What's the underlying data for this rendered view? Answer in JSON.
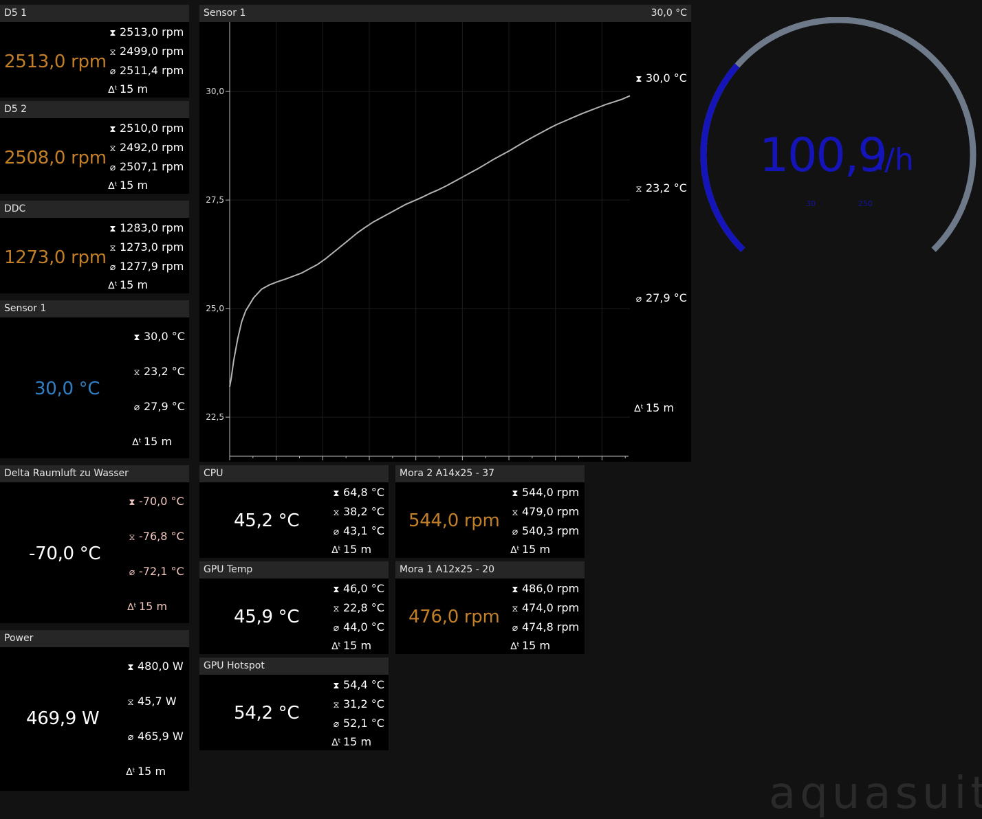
{
  "units": {
    "rpm": "rpm",
    "temp": "°C",
    "watt": "W",
    "time": "15 m"
  },
  "panels": {
    "d5_1": {
      "title": "D5 1",
      "value": "2513,0 rpm",
      "max": "2513,0 rpm",
      "min": "2499,0 rpm",
      "avg": "2511,4 rpm",
      "dt": "15 m"
    },
    "d5_2": {
      "title": "D5 2",
      "value": "2508,0 rpm",
      "max": "2510,0 rpm",
      "min": "2492,0 rpm",
      "avg": "2507,1 rpm",
      "dt": "15 m"
    },
    "ddc": {
      "title": "DDC",
      "value": "1273,0 rpm",
      "max": "1283,0 rpm",
      "min": "1273,0 rpm",
      "avg": "1277,9 rpm",
      "dt": "15 m"
    },
    "sensor1": {
      "title": "Sensor 1",
      "value": "30,0 °C",
      "max": "30,0 °C",
      "min": "23,2 °C",
      "avg": "27,9 °C",
      "dt": "15 m"
    },
    "delta": {
      "title": "Delta Raumluft zu Wasser",
      "value": "-70,0 °C",
      "max": "-70,0 °C",
      "min": "-76,8 °C",
      "avg": "-72,1 °C",
      "dt": "15 m"
    },
    "power": {
      "title": "Power",
      "value": "469,9 W",
      "max": "480,0 W",
      "min": "45,7 W",
      "avg": "465,9 W",
      "dt": "15 m"
    },
    "cpu": {
      "title": "CPU",
      "value": "45,2 °C",
      "max": "64,8 °C",
      "min": "38,2 °C",
      "avg": "43,1 °C",
      "dt": "15 m"
    },
    "gpu_temp": {
      "title": "GPU Temp",
      "value": "45,9 °C",
      "max": "46,0 °C",
      "min": "22,8 °C",
      "avg": "44,0 °C",
      "dt": "15 m"
    },
    "gpu_hotspot": {
      "title": "GPU Hotspot",
      "value": "54,2 °C",
      "max": "54,4 °C",
      "min": "31,2 °C",
      "avg": "52,1 °C",
      "dt": "15 m"
    },
    "mora2": {
      "title": "Mora 2 A14x25 - 37",
      "value": "544,0 rpm",
      "max": "544,0 rpm",
      "min": "479,0 rpm",
      "avg": "540,3 rpm",
      "dt": "15 m"
    },
    "mora1": {
      "title": "Mora 1 A12x25 - 20",
      "value": "476,0 rpm",
      "max": "486,0 rpm",
      "min": "474,0 rpm",
      "avg": "474,8 rpm",
      "dt": "15 m"
    }
  },
  "chart_panel": {
    "title": "Sensor 1",
    "current": "30,0 °C",
    "max": "30,0 °C",
    "min": "23,2 °C",
    "avg": "27,9 °C",
    "dt": "15 m"
  },
  "chart_data": {
    "type": "line",
    "title": "Sensor 1",
    "xlabel": "",
    "ylabel": "",
    "ylim": [
      21.6,
      31.6
    ],
    "yticks": [
      "22,5",
      "25,0",
      "27,5",
      "30,0"
    ],
    "ytick_values": [
      22.5,
      25.0,
      27.5,
      30.0
    ],
    "grid": true,
    "x": [
      0,
      0.2,
      0.5,
      1,
      1.5,
      2,
      3,
      4,
      5,
      6,
      7,
      8,
      9,
      10,
      11,
      12,
      13,
      14,
      15,
      16,
      17,
      18,
      19,
      20,
      21,
      22,
      23,
      24,
      25,
      26,
      27,
      28,
      29,
      30,
      31,
      32,
      33,
      34,
      35,
      36,
      37,
      38,
      39,
      40,
      41,
      42,
      43,
      44,
      45,
      46,
      47,
      48,
      49,
      50
    ],
    "series": [
      {
        "values": [
          23.2,
          23.4,
          23.8,
          24.3,
          24.7,
          24.95,
          25.25,
          25.45,
          25.55,
          25.62,
          25.68,
          25.75,
          25.82,
          25.92,
          26.02,
          26.15,
          26.3,
          26.45,
          26.6,
          26.75,
          26.88,
          27.0,
          27.1,
          27.2,
          27.3,
          27.4,
          27.48,
          27.56,
          27.65,
          27.73,
          27.82,
          27.92,
          28.02,
          28.12,
          28.22,
          28.33,
          28.44,
          28.54,
          28.64,
          28.75,
          28.86,
          28.96,
          29.06,
          29.16,
          29.25,
          29.33,
          29.41,
          29.49,
          29.56,
          29.63,
          29.7,
          29.76,
          29.82,
          29.9
        ]
      }
    ]
  },
  "gauge": {
    "value": "100,9",
    "unit": "l/h",
    "scale_min": "30",
    "scale_max": "250",
    "fraction": 0.32,
    "arc_color": "#1414b8",
    "track_color": "#6e7a8a"
  },
  "watermark": "aquasuite"
}
